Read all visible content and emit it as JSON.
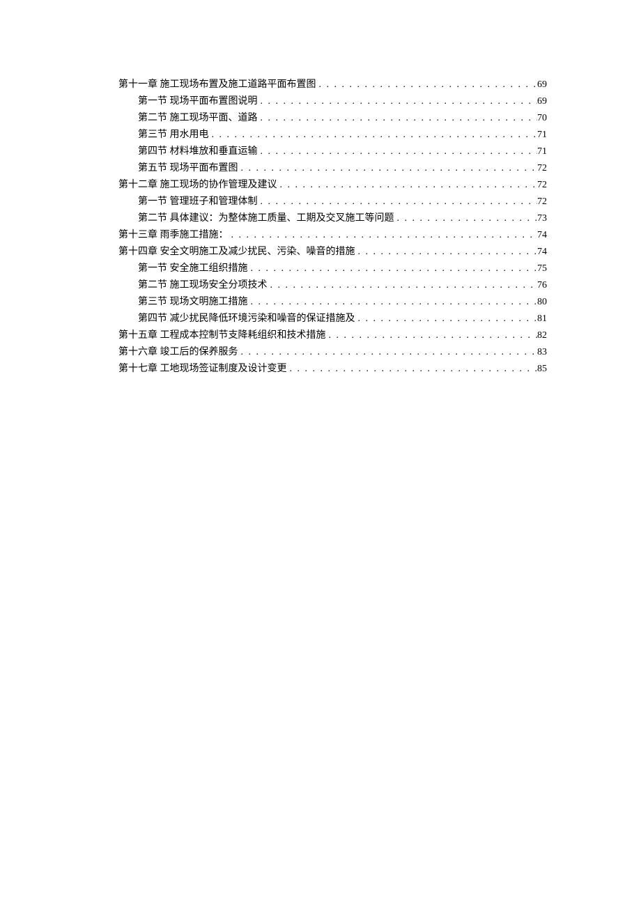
{
  "toc": [
    {
      "level": 1,
      "label": "第十一章 施工现场布置及施工道路平面布置图",
      "page": "69"
    },
    {
      "level": 2,
      "label": "第一节 现场平面布置图说明",
      "page": "69"
    },
    {
      "level": 2,
      "label": "第二节 施工现场平面、道路",
      "page": "70"
    },
    {
      "level": 2,
      "label": "第三节 用水用电",
      "page": "71"
    },
    {
      "level": 2,
      "label": "第四节 材料堆放和垂直运输",
      "page": "71"
    },
    {
      "level": 2,
      "label": "第五节 现场平面布置图",
      "page": "72"
    },
    {
      "level": 1,
      "label": "第十二章 施工现场的协作管理及建议",
      "page": "72"
    },
    {
      "level": 2,
      "label": "第一节 管理班子和管理体制",
      "page": "72"
    },
    {
      "level": 2,
      "label": "第二节 具体建议：为整体施工质量、工期及交叉施工等问题",
      "page": "73"
    },
    {
      "level": 1,
      "label": "第十三章 雨季施工措施：",
      "page": "74"
    },
    {
      "level": 1,
      "label": "第十四章 安全文明施工及减少扰民、污染、噪音的措施",
      "page": "74"
    },
    {
      "level": 2,
      "label": "第一节 安全施工组织措施",
      "page": "75"
    },
    {
      "level": 2,
      "label": "第二节 施工现场安全分项技术",
      "page": "76"
    },
    {
      "level": 2,
      "label": "第三节 现场文明施工措施",
      "page": "80"
    },
    {
      "level": 2,
      "label": "第四节 减少扰民降低环境污染和噪音的保证措施及",
      "page": "81"
    },
    {
      "level": 1,
      "label": "第十五章 工程成本控制节支降耗组织和技术措施",
      "page": "82"
    },
    {
      "level": 1,
      "label": "第十六章 竣工后的保养服务",
      "page": "83"
    },
    {
      "level": 1,
      "label": "第十七章 工地现场签证制度及设计变更",
      "page": "85"
    }
  ]
}
